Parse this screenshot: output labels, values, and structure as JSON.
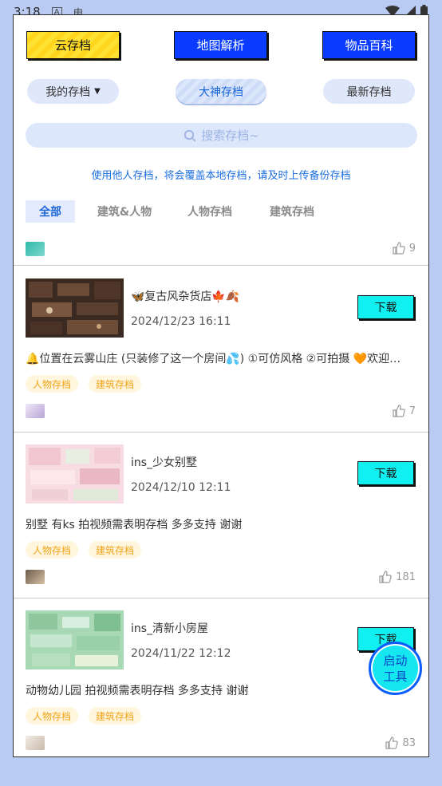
{
  "status": {
    "time": "3:18",
    "icon_a": "A",
    "icon_b": "电"
  },
  "top_tools": {
    "cloud": "云存档",
    "map": "地图解析",
    "items": "物品百科"
  },
  "sub_tabs": {
    "mine": "我的存档",
    "master": "大神存档",
    "newest": "最新存档"
  },
  "search": {
    "placeholder": "搜索存档~"
  },
  "notice": "使用他人存档，将会覆盖本地存档，请及时上传备份存档",
  "categories": [
    "全部",
    "建筑&人物",
    "人物存档",
    "建筑存档"
  ],
  "first_partial": {
    "likes": "9"
  },
  "posts": [
    {
      "title": "🦋复古风杂货店🍁🍂",
      "date": "2024/12/23 16:11",
      "download": "下载",
      "desc": "🔔位置在云雾山庄 (只装修了这一个房间💦) ①可仿风格 ②可拍摄 🧡欢迎…",
      "tags": [
        "人物存档",
        "建筑存档"
      ],
      "likes": "7"
    },
    {
      "title": "ins_少女别墅",
      "date": "2024/12/10 12:11",
      "download": "下载",
      "desc": "别墅  有ks   拍视频需表明存档   多多支持   谢谢",
      "tags": [
        "人物存档",
        "建筑存档"
      ],
      "likes": "181"
    },
    {
      "title": "ins_清新小房屋",
      "date": "2024/11/22 12:12",
      "download": "下载",
      "desc": "动物幼儿园   拍视频需表明存档   多多支持   谢谢",
      "tags": [
        "人物存档",
        "建筑存档"
      ],
      "likes": "83"
    }
  ],
  "fab": {
    "line1": "启动",
    "line2": "工具"
  },
  "colors": {
    "accent_blue": "#0a3cff",
    "cyan": "#11f0f0",
    "yellow": "#ffe233",
    "tag_orange": "#f0a41a"
  }
}
